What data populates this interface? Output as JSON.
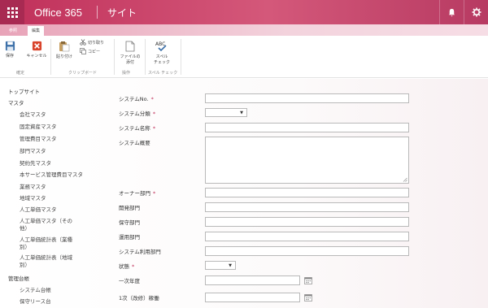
{
  "suite_bar": {
    "brand": "Office 365",
    "site": "サイト",
    "icons": [
      "waffle-icon",
      "bell-icon",
      "gear-icon"
    ]
  },
  "ribbon": {
    "tabs": [
      "参照",
      "編集"
    ],
    "buttons": {
      "save": "保存",
      "cancel": "キャンセル",
      "paste": "貼り付け",
      "cut": "切り取り",
      "copy": "コピー",
      "attach_file": [
        "ファイルの",
        "添付"
      ],
      "spelling": [
        "スペル",
        "チェック"
      ]
    },
    "groups": {
      "commit": "確定",
      "clipboard": "クリップボード",
      "actions": "操作",
      "spelling": "スペル チェック"
    },
    "colors": {
      "accent": "#c0305a"
    }
  },
  "nav": {
    "top_site": "トップサイト",
    "master": "マスタ",
    "master_items": [
      "会社マスタ",
      "固定資産マスタ",
      "管理費目マスタ",
      "部門マスタ",
      "契約先マスタ",
      "本サービス管理費目マスタ",
      "業務マスタ",
      "地域マスタ",
      "人工単価マスタ",
      "人工単価マスタ（その",
      "他）",
      "人工単価統計表（業種",
      "別）",
      "人工単価統計表（地域",
      "別）"
    ],
    "ledger": "管理台帳",
    "ledger_items": [
      "システム台帳",
      "保守リース台"
    ]
  },
  "form": {
    "system_no": {
      "label": "システムNo.",
      "required": "*"
    },
    "system_type": {
      "label": "システム分類",
      "required": "*"
    },
    "system_name": {
      "label": "システム名称",
      "required": "*"
    },
    "system_overview": {
      "label": "システム概要"
    },
    "owner_dept": {
      "label": "オーナー部門",
      "required": "*"
    },
    "dev_dept": {
      "label": "開発部門"
    },
    "maint_dept": {
      "label": "保守部門"
    },
    "ops_dept": {
      "label": "運用部門"
    },
    "user_dept": {
      "label": "システム利用部門"
    },
    "status": {
      "label": "状態",
      "required": "*"
    },
    "first_year": {
      "label": "一次年度"
    },
    "second_update": {
      "label": "1次（改修）稼働"
    }
  }
}
